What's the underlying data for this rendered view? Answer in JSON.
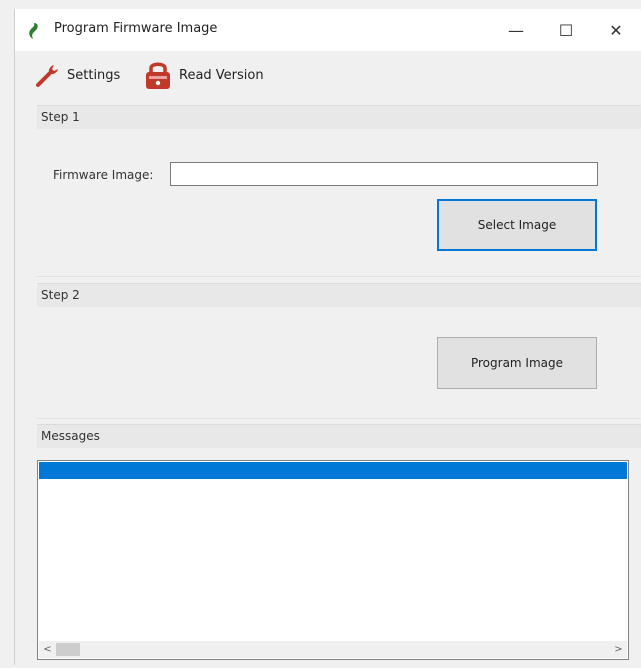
{
  "window": {
    "title": "Program Firmware Image",
    "minimize_glyph": "—",
    "maximize_glyph": "☐",
    "close_glyph": "✕"
  },
  "toolbar": {
    "settings_label": "Settings",
    "read_version_label": "Read Version",
    "settings_icon": "wrench-icon",
    "read_version_icon": "padlock-icon"
  },
  "step1": {
    "title": "Step 1",
    "firmware_label": "Firmware Image:",
    "firmware_value": "",
    "select_button": "Select Image"
  },
  "step2": {
    "title": "Step 2",
    "program_button": "Program Image"
  },
  "messages": {
    "title": "Messages",
    "items": [
      ""
    ],
    "scroll_left": "<",
    "scroll_right": ">"
  },
  "colors": {
    "accent": "#0078d7",
    "icon_red": "#c0392b",
    "app_icon_green": "#2e7d32"
  }
}
